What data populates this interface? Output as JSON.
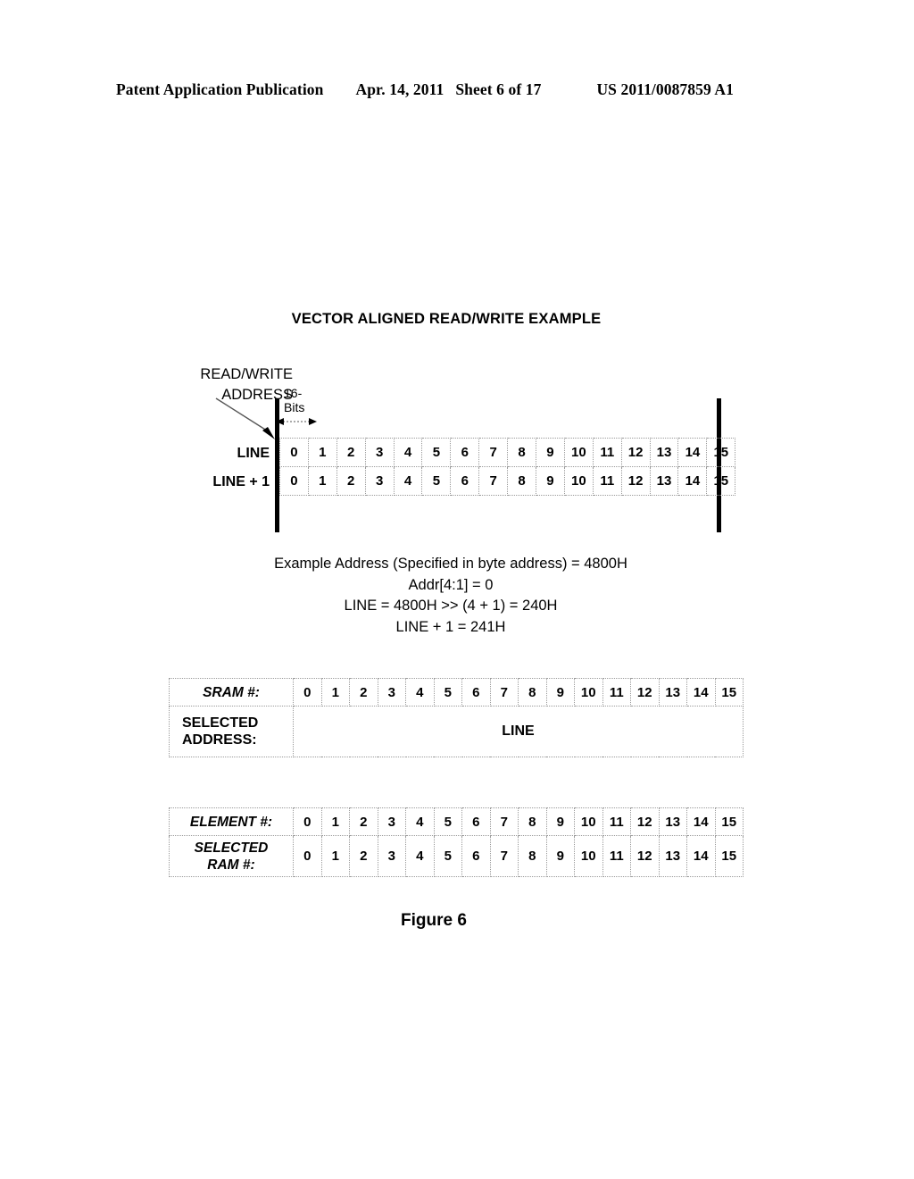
{
  "header": {
    "publication": "Patent Application Publication",
    "date": "Apr. 14, 2011",
    "sheet": "Sheet 6 of 17",
    "document_number": "US 2011/0087859 A1"
  },
  "figure": {
    "title": "VECTOR ALIGNED READ/WRITE EXAMPLE",
    "caption": "Figure 6"
  },
  "callout": {
    "line1": "READ/WRITE",
    "line2": "ADDRESS"
  },
  "bits_annotation": {
    "line1": "16-",
    "line2": "Bits"
  },
  "line_grid": {
    "row_labels": [
      "LINE",
      "LINE + 1"
    ],
    "rows": [
      [
        "0",
        "1",
        "2",
        "3",
        "4",
        "5",
        "6",
        "7",
        "8",
        "9",
        "10",
        "11",
        "12",
        "13",
        "14",
        "15"
      ],
      [
        "0",
        "1",
        "2",
        "3",
        "4",
        "5",
        "6",
        "7",
        "8",
        "9",
        "10",
        "11",
        "12",
        "13",
        "14",
        "15"
      ]
    ]
  },
  "formula": {
    "line1": "Example Address (Specified in byte address) = 4800H",
    "line2": "Addr[4:1] = 0",
    "line3": "LINE = 4800H >> (4 + 1) = 240H",
    "line4": "LINE + 1 = 241H"
  },
  "sram_table": {
    "row1_label": "SRAM #:",
    "row1_values": [
      "0",
      "1",
      "2",
      "3",
      "4",
      "5",
      "6",
      "7",
      "8",
      "9",
      "10",
      "11",
      "12",
      "13",
      "14",
      "15"
    ],
    "row2_label_line1": "SELECTED",
    "row2_label_line2": "ADDRESS:",
    "row2_value": "LINE"
  },
  "element_table": {
    "row1_label": "ELEMENT #:",
    "row1_values": [
      "0",
      "1",
      "2",
      "3",
      "4",
      "5",
      "6",
      "7",
      "8",
      "9",
      "10",
      "11",
      "12",
      "13",
      "14",
      "15"
    ],
    "row2_label_line1": "SELECTED",
    "row2_label_line2": "RAM #:",
    "row2_values": [
      "0",
      "1",
      "2",
      "3",
      "4",
      "5",
      "6",
      "7",
      "8",
      "9",
      "10",
      "11",
      "12",
      "13",
      "14",
      "15"
    ]
  }
}
